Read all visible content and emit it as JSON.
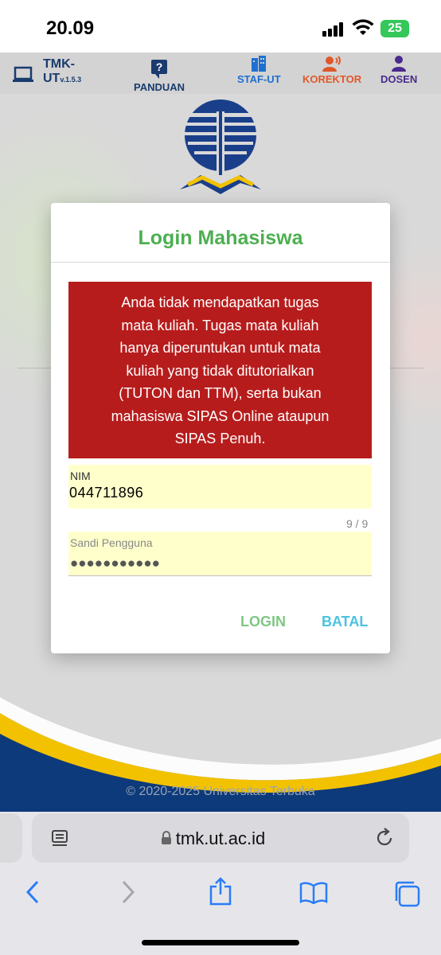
{
  "status": {
    "time": "20.09",
    "battery": "25"
  },
  "nav": {
    "brand_line1": "TMK-",
    "brand_line2": "UT",
    "version": "v.1.5.3",
    "items": [
      {
        "label": "PANDUAN",
        "color": "#1a3b6e"
      },
      {
        "label": "STAF-UT",
        "color": "#1e6fd0"
      },
      {
        "label": "KOREKTOR",
        "color": "#e0582a"
      },
      {
        "label": "DOSEN",
        "color": "#4a2a8c"
      }
    ]
  },
  "dialog": {
    "title": "Login Mahasiswa",
    "alert_lines": [
      "Anda tidak mendapatkan tugas",
      "mata kuliah.  Tugas mata kuliah",
      "hanya diperuntukan untuk mata",
      "kuliah yang tidak ditutorialkan",
      "(TUTON dan TTM), serta bukan",
      "mahasiswa SIPAS Online ataupun",
      "SIPAS Penuh."
    ],
    "nim_label": "NIM",
    "nim_value": "044711896",
    "nim_counter": "9 / 9",
    "password_label": "Sandi Pengguna",
    "password_mask": "●●●●●●●●●●●",
    "login_label": "LOGIN",
    "cancel_label": "BATAL"
  },
  "footer": {
    "copyright": "© 2020-2025 Universitas Terbuka"
  },
  "browser": {
    "url": "tmk.ut.ac.id"
  },
  "colors": {
    "title_green": "#4caf50",
    "alert_red": "#b71c1c",
    "field_yellow": "#ffffcc",
    "footer_navy": "#0d3a7a",
    "footer_gold": "#f2c200"
  }
}
